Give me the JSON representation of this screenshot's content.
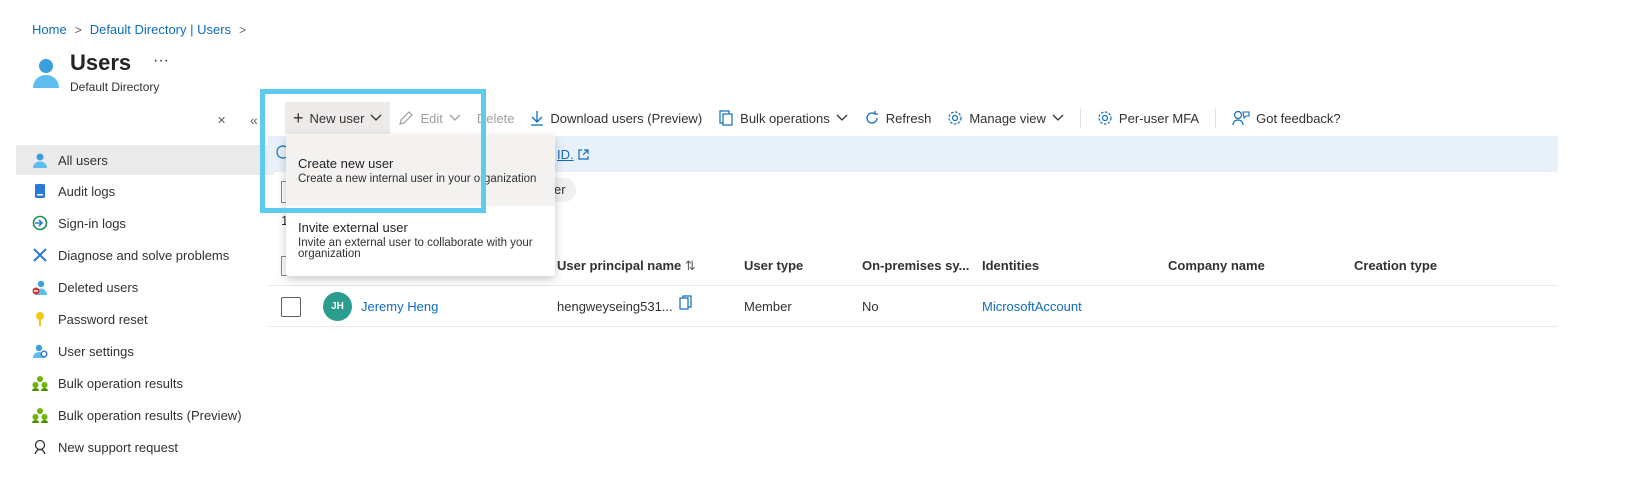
{
  "breadcrumb": {
    "home": "Home",
    "directory": "Default Directory | Users",
    "sep": ">"
  },
  "header": {
    "title": "Users",
    "more": "···",
    "subtitle": "Default Directory"
  },
  "sidebar": {
    "collapse": "✕",
    "collapse_all": "«",
    "items": [
      {
        "label": "All users",
        "icon": "user-icon"
      },
      {
        "label": "Audit logs",
        "icon": "audit-log-icon"
      },
      {
        "label": "Sign-in logs",
        "icon": "sign-in-icon"
      },
      {
        "label": "Diagnose and solve problems",
        "icon": "wrench-icon"
      },
      {
        "label": "Deleted users",
        "icon": "deleted-user-icon"
      },
      {
        "label": "Password reset",
        "icon": "key-icon"
      },
      {
        "label": "User settings",
        "icon": "user-settings-icon"
      },
      {
        "label": "Bulk operation results",
        "icon": "group-icon"
      },
      {
        "label": "Bulk operation results (Preview)",
        "icon": "group-icon"
      },
      {
        "label": "New support request",
        "icon": "support-icon"
      }
    ]
  },
  "toolbar": {
    "new_user": "New user",
    "edit": "Edit",
    "delete": "Delete",
    "download": "Download users (Preview)",
    "bulk": "Bulk operations",
    "refresh": "Refresh",
    "manage_view": "Manage view",
    "per_user_mfa": "Per-user MFA",
    "feedback": "Got feedback?"
  },
  "banner": {
    "link": "ID."
  },
  "filter": {
    "pill_text": "er"
  },
  "peek": {
    "count": "1"
  },
  "dropdown": {
    "items": [
      {
        "title": "Create new user",
        "desc": "Create a new internal user in your organization"
      },
      {
        "title": "Invite external user",
        "desc": "Invite an external user to collaborate with your organization"
      }
    ]
  },
  "table": {
    "columns": [
      "User principal name",
      "User type",
      "On-premises sy...",
      "Identities",
      "Company name",
      "Creation type"
    ],
    "sort_icon": "⇅",
    "rows": [
      {
        "initials": "JH",
        "name": "Jeremy Heng",
        "upn": "hengweyseing531...",
        "type": "Member",
        "onprem": "No",
        "identities": "MicrosoftAccount",
        "company": "",
        "creation": ""
      }
    ]
  },
  "colors": {
    "accent": "#0f6cbd",
    "highlight": "#5ccbef",
    "avatar": "#2a9d8f",
    "banner": "#e8f1fa"
  }
}
